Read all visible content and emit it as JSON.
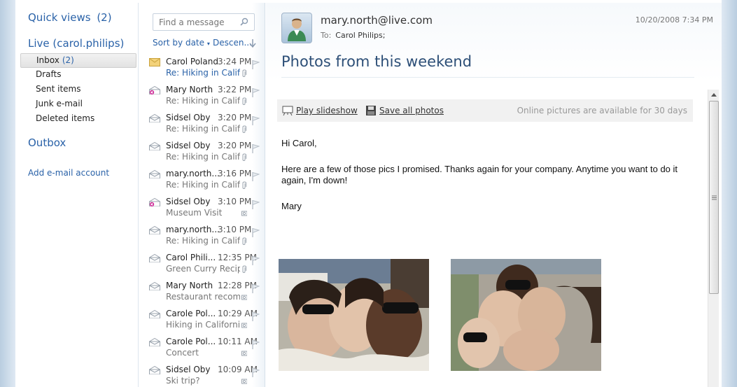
{
  "folders": {
    "quick_views_label": "Quick views",
    "quick_views_count": "(2)",
    "account_label": "Live (carol.philips)",
    "items": [
      {
        "label": "Inbox",
        "count": "(2)"
      },
      {
        "label": "Drafts",
        "count": ""
      },
      {
        "label": "Sent items",
        "count": ""
      },
      {
        "label": "Junk e-mail",
        "count": ""
      },
      {
        "label": "Deleted items",
        "count": ""
      }
    ],
    "outbox_label": "Outbox",
    "add_account_label": "Add e-mail account"
  },
  "list": {
    "search_placeholder": "Find a message",
    "sort_by": "Sort by date",
    "sort_order": "Descen...",
    "messages": [
      {
        "sender": "Carol Poland",
        "time": "3:24 PM",
        "subject": "Re: Hiking in Calif...",
        "icon": "envelope-closed-icon",
        "unread": true,
        "attach": true
      },
      {
        "sender": "Mary North",
        "time": "3:22 PM",
        "subject": "Re: Hiking in Calif...",
        "icon": "envelope-reply-icon",
        "unread": false,
        "attach": true
      },
      {
        "sender": "Sidsel Oby",
        "time": "3:20 PM",
        "subject": "Re: Hiking in Calif...",
        "icon": "envelope-open-icon",
        "unread": false,
        "attach": true
      },
      {
        "sender": "Sidsel Oby",
        "time": "3:20 PM",
        "subject": "Re: Hiking in Calif...",
        "icon": "envelope-open-icon",
        "unread": false,
        "attach": true
      },
      {
        "sender": "mary.north...",
        "time": "3:16 PM",
        "subject": "Re: Hiking in Calif...",
        "icon": "envelope-open-icon",
        "unread": false,
        "attach": true
      },
      {
        "sender": "Sidsel Oby",
        "time": "3:10 PM",
        "subject": "Museum Visit",
        "icon": "envelope-reply-icon",
        "unread": false,
        "attach": false
      },
      {
        "sender": "mary.north...",
        "time": "3:10 PM",
        "subject": "Re: Hiking in Calif...",
        "icon": "envelope-open-icon",
        "unread": false,
        "attach": true
      },
      {
        "sender": "Carol Phili...",
        "time": "12:35 PM",
        "subject": "Green Curry Recipe",
        "icon": "envelope-open-icon",
        "unread": false,
        "attach": true
      },
      {
        "sender": "Mary North",
        "time": "12:28 PM",
        "subject": "Restaurant recomm...",
        "icon": "envelope-open-icon",
        "unread": false,
        "attach": false
      },
      {
        "sender": "Carole Pol...",
        "time": "10:29 AM",
        "subject": "Hiking in California",
        "icon": "envelope-open-icon",
        "unread": false,
        "attach": false
      },
      {
        "sender": "Carole Pol...",
        "time": "10:11 AM",
        "subject": "Concert",
        "icon": "envelope-open-icon",
        "unread": false,
        "attach": false
      },
      {
        "sender": "Sidsel Oby",
        "time": "10:09 AM",
        "subject": "Ski trip?",
        "icon": "envelope-open-icon",
        "unread": false,
        "attach": false
      }
    ]
  },
  "reading": {
    "from": "mary.north@live.com",
    "to_label": "To:",
    "to_name": "Carol Philips;",
    "date": "10/20/2008 7:34 PM",
    "subject": "Photos from this weekend",
    "play_slideshow": "Play slideshow",
    "save_all_photos": "Save all photos",
    "availability_note": "Online pictures are available for 30 days",
    "body": {
      "greeting": "Hi Carol,",
      "paragraph": "Here are a few of those pics I promised. Thanks again for your company. Anytime you want to do it again, I'm down!",
      "signature": "Mary"
    }
  },
  "colors": {
    "accent": "#2a62a8",
    "subject_title": "#2d4f77"
  }
}
